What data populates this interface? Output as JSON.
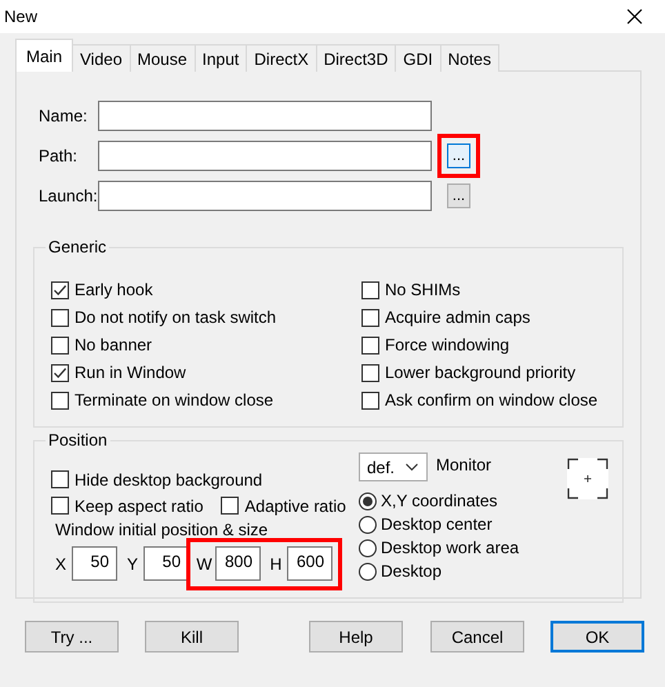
{
  "window": {
    "title": "New"
  },
  "tabs": [
    {
      "label": "Main",
      "selected": true
    },
    {
      "label": "Video",
      "selected": false
    },
    {
      "label": "Mouse",
      "selected": false
    },
    {
      "label": "Input",
      "selected": false
    },
    {
      "label": "DirectX",
      "selected": false
    },
    {
      "label": "Direct3D",
      "selected": false
    },
    {
      "label": "GDI",
      "selected": false
    },
    {
      "label": "Notes",
      "selected": false
    }
  ],
  "fields": [
    {
      "label": "Name:"
    },
    {
      "label": "Path:",
      "browse": {
        "label": "...",
        "focused": true,
        "highlighted": true
      }
    },
    {
      "label": "Launch:",
      "browse": {
        "label": "...",
        "focused": false
      }
    }
  ],
  "generic": {
    "title": "Generic",
    "columns": [
      [
        {
          "label": "Early hook",
          "checked": true
        },
        {
          "label": "Do not notify on task switch",
          "checked": false
        },
        {
          "label": "No banner",
          "checked": false
        },
        {
          "label": "Run in Window",
          "checked": true
        },
        {
          "label": "Terminate on window close",
          "checked": false
        }
      ],
      [
        {
          "label": "No SHIMs",
          "checked": false
        },
        {
          "label": "Acquire admin caps",
          "checked": false
        },
        {
          "label": "Force windowing",
          "checked": false
        },
        {
          "label": "Lower background priority",
          "checked": false
        },
        {
          "label": "Ask confirm on window close",
          "checked": false
        }
      ]
    ]
  },
  "position": {
    "title": "Position",
    "checkbox_rows": [
      [
        {
          "label": "Hide desktop background",
          "checked": false
        }
      ],
      [
        {
          "label": "Keep aspect ratio",
          "checked": false
        },
        {
          "label": "Adaptive ratio",
          "checked": false
        }
      ]
    ],
    "size_label": "Window initial position & size",
    "coord_groups": [
      {
        "items": [
          {
            "label": "X",
            "value": "50"
          },
          {
            "label": "Y",
            "value": "50"
          }
        ]
      },
      {
        "highlighted": true,
        "items": [
          {
            "label": "W",
            "value": "800"
          },
          {
            "label": "H",
            "value": "600"
          }
        ]
      }
    ],
    "monitor": {
      "value": "def.",
      "label": "Monitor"
    },
    "radios": [
      {
        "label": "X,Y coordinates",
        "selected": true
      },
      {
        "label": "Desktop center",
        "selected": false
      },
      {
        "label": "Desktop work area",
        "selected": false
      },
      {
        "label": "Desktop",
        "selected": false
      }
    ]
  },
  "buttons": [
    {
      "label": "Try ...",
      "default": false
    },
    {
      "label": "Kill",
      "default": false
    },
    {
      "label": "Help",
      "default": false
    },
    {
      "label": "Cancel",
      "default": false
    },
    {
      "label": "OK",
      "default": true
    }
  ]
}
